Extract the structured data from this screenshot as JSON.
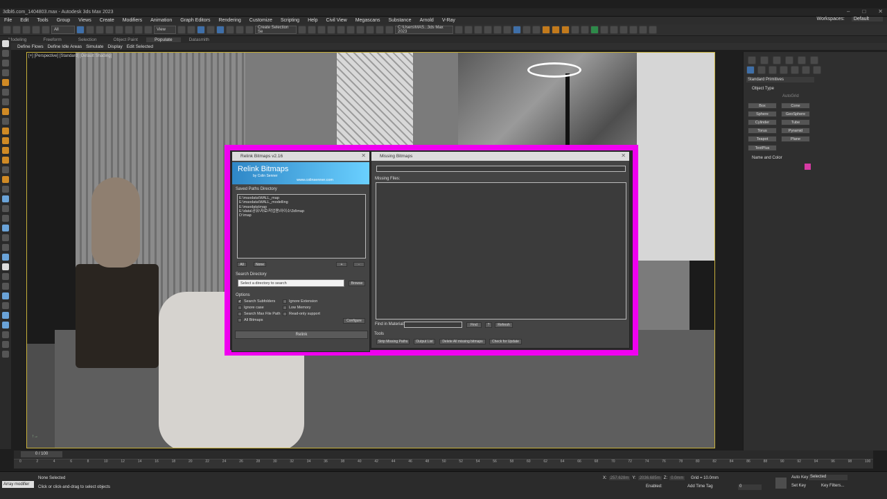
{
  "window": {
    "title": "3dbl6.com_1404803.max - Autodesk 3ds Max 2023",
    "controls": [
      "–",
      "□",
      "✕"
    ]
  },
  "menu": {
    "items": [
      "File",
      "Edit",
      "Tools",
      "Group",
      "Views",
      "Create",
      "Modifiers",
      "Animation",
      "Graph Editors",
      "Rendering",
      "Customize",
      "Scripting",
      "Help",
      "Civil View",
      "Megascans",
      "Substance",
      "Arnold",
      "V-Ray"
    ],
    "workspaces_label": "Workspaces:",
    "workspaces_value": "Default"
  },
  "toolbar": {
    "filter_value": "All",
    "view_value": "View",
    "selection_set_placeholder": "Create Selection Se",
    "path_value": "C:\\Users\\MAS...3ds Max 2023"
  },
  "ribbon": {
    "tabs": [
      "Modeling",
      "Freeform",
      "Selection",
      "Object Paint",
      "Populate",
      "Datasmith"
    ],
    "active": "Populate",
    "subitems": [
      "Define Flows",
      "Define Idle Areas",
      "Simulate",
      "Display",
      "Edit Selected"
    ]
  },
  "viewport": {
    "label": "[+] [Perspective] [Standard] [Default Shading]"
  },
  "relink_dialog": {
    "title": "Relink Bitmaps v2.16",
    "banner_title": "Relink Bitmaps",
    "banner_by": "by Colin Senner",
    "banner_url": "www.colinsenner.com",
    "saved_paths_label": "Saved Paths Directory",
    "saved_paths": [
      "E:\\maxdata\\WALL_map",
      "E:\\maxdata\\WALL_modelling",
      "E:\\maxdata\\map",
      "E:\\data\\공유\\자료\\작업용\\아이소\\3d\\map",
      "D:\\map"
    ],
    "btn_all": "All",
    "btn_none": "None",
    "btn_plus": "+",
    "btn_minus": "-",
    "search_dir_label": "Search Directory",
    "search_dir_placeholder": "Select a directory to search",
    "btn_browse": "Browse",
    "options_label": "Options",
    "opt_search_subfolders": "Search Subfolders",
    "opt_search_subfolders_checked": true,
    "opt_ignore_case": "Ignore case",
    "opt_search_max_path": "Search Max File Path",
    "opt_all_bitmaps": "All Bitmaps",
    "opt_ignore_ext": "Ignore Extension",
    "opt_low_memory": "Low Memory",
    "opt_readonly": "Read-only support",
    "btn_configure": "Configure",
    "btn_relink": "Relink"
  },
  "missing_dialog": {
    "title": "Missing Bitmaps",
    "missing_files_label": "Missing Files:",
    "find_label": "Find in Material:",
    "btn_find": "Find",
    "btn_q": "?",
    "btn_refresh": "Refresh",
    "tools_label": "Tools",
    "btn_strip": "Strip Missing Paths",
    "btn_output": "Output List",
    "btn_delete": "Delete All missing bitmaps",
    "btn_update": "Check for Update"
  },
  "command_panel": {
    "dropdown": "Standard Primitives",
    "object_type": "Object Type",
    "autogrid": "AutoGrid",
    "buttons": [
      "Box",
      "Cone",
      "Sphere",
      "GeoSphere",
      "Cylinder",
      "Tube",
      "Torus",
      "Pyramid",
      "Teapot",
      "Plane",
      "TextPlus"
    ],
    "name_color": "Name and Color",
    "swatch_color": "#d63aa3"
  },
  "timeline": {
    "frame": "0 / 100",
    "ticks": [
      "0",
      "2",
      "4",
      "6",
      "8",
      "10",
      "12",
      "14",
      "16",
      "18",
      "20",
      "22",
      "24",
      "26",
      "28",
      "30",
      "32",
      "34",
      "36",
      "38",
      "40",
      "42",
      "44",
      "46",
      "48",
      "50",
      "52",
      "54",
      "56",
      "58",
      "60",
      "62",
      "64",
      "66",
      "68",
      "70",
      "72",
      "74",
      "76",
      "78",
      "80",
      "82",
      "84",
      "86",
      "88",
      "90",
      "92",
      "94",
      "96",
      "98",
      "100"
    ]
  },
  "status": {
    "modifier_label": "Array modifier",
    "none_selected": "None Selected",
    "prompt": "Click or click-and-drag to select objects",
    "x_label": "X:",
    "x_value": "257.628m",
    "y_label": "Y:",
    "y_value": "2036.685m",
    "z_label": "Z:",
    "z_value": "0.0mm",
    "grid": "Grid = 10.0mm",
    "add_time_tag": "Add Time Tag",
    "enabled": "Enabled:",
    "auto_key": "Auto Key",
    "set_key": "Set Key",
    "selected": "Selected",
    "key_filters": "Key Filters...",
    "frame_field": "0"
  }
}
